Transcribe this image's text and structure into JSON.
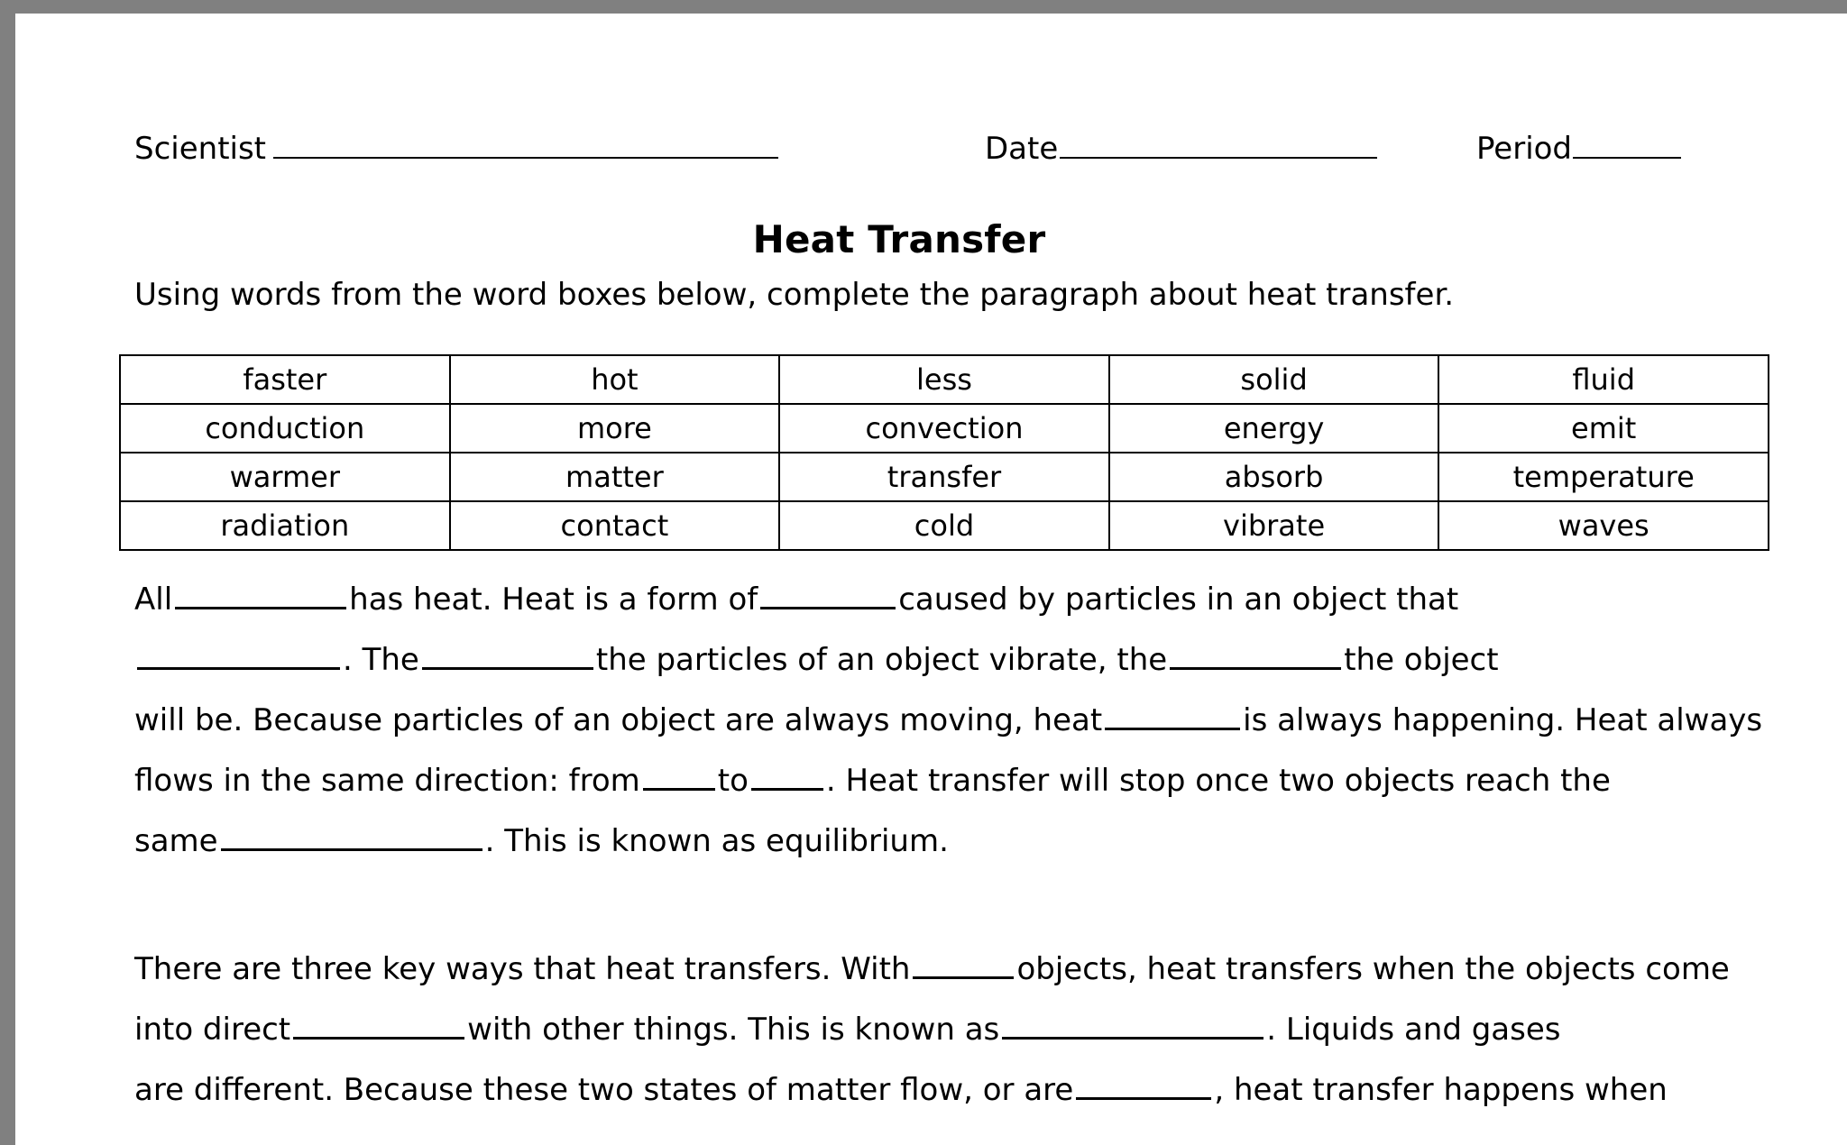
{
  "document": {
    "title": "Heat Transfer",
    "instruction": "Using words from the word boxes below, complete the paragraph about heat transfer."
  },
  "header": {
    "scientist_label": "Scientist",
    "date_label": "Date",
    "period_label": "Period",
    "scientist_value": "",
    "date_value": "",
    "period_value": ""
  },
  "word_bank": {
    "rows": [
      [
        "faster",
        "hot",
        "less",
        "solid",
        "fluid"
      ],
      [
        "conduction",
        "more",
        "convection",
        "energy",
        "emit"
      ],
      [
        "warmer",
        "matter",
        "transfer",
        "absorb",
        "temperature"
      ],
      [
        "radiation",
        "contact",
        "cold",
        "vibrate",
        "waves"
      ]
    ]
  },
  "paragraph_1": {
    "line_1_a": "All",
    "line_1_b": "has heat. Heat is a form of",
    "line_1_c": "caused by particles in an object that",
    "line_2_a": "",
    "line_2_b": ". The",
    "line_2_c": "the particles of an object vibrate, the",
    "line_2_d": "the object",
    "line_3_a": "will be. Because particles of an object are always moving, heat",
    "line_3_b": "is always happening. Heat always",
    "line_4_a": "flows in the same direction: from",
    "line_4_b": "to",
    "line_4_c": ". Heat transfer will stop once two objects reach the",
    "line_5_a": "same",
    "line_5_b": ". This is known as equilibrium."
  },
  "paragraph_2": {
    "line_1_a": "There are three key ways that heat transfers. With",
    "line_1_b": "objects, heat transfers when the objects come",
    "line_2_a": "into direct",
    "line_2_b": "with other things. This is known as",
    "line_2_c": ". Liquids and gases",
    "line_3_a": "are different. Because these two states of matter flow, or are",
    "line_3_b": ", heat transfer happens when"
  },
  "colors": {
    "page_background": "#808080",
    "sheet": "#ffffff",
    "text": "#000000",
    "rule": "#000000"
  }
}
